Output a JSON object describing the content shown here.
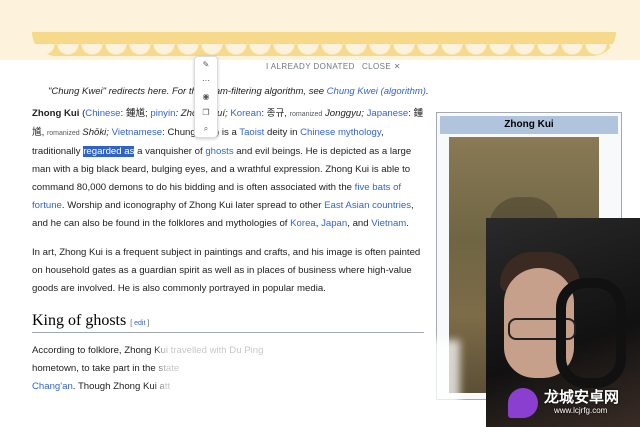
{
  "banner": {
    "donated_label": "I ALREADY DONATED",
    "close_label": "CLOSE ✕"
  },
  "hatnote": {
    "text": "\"Chung Kwei\" redirects here. For the spam-filtering algorithm, see ",
    "link": "Chung Kwei (algorithm)",
    "end": "."
  },
  "p1": {
    "name": "Zhong Kui",
    "s1": " (",
    "chinese_label": "Chinese",
    "chinese": ": 鍾馗; ",
    "pinyin_label": "pinyin",
    "pinyin": ": Zhōng Kuí; ",
    "korean_label": "Korean",
    "korean": ": 종규, ",
    "romanized1": "romanized",
    "korean_rom": " Jonggyu;",
    "japanese_label": "Japanese",
    "japanese": ": 鍾馗, ",
    "romanized2": "romanized",
    "shoki": " Shōki; ",
    "viet_label": "Vietnamese",
    "viet": ": Chung Quỳ) is a ",
    "taoist": "Taoist",
    "deity_in": " deity in ",
    "chinese_myth": "Chinese mythology",
    "trad_pre": ", traditionally ",
    "highlight": "regarded as",
    "trad_post": " a vanquisher of ",
    "ghosts": "ghosts",
    "rest1": " and evil beings. He is depicted as a large man with a big black beard, bulging eyes, and a wrathful expression. Zhong Kui is able to command 80,000 demons to do his bidding and is often associated with the ",
    "five_bats": "five bats of fortune",
    "rest2": ". Worship and iconography of Zhong Kui later spread to other ",
    "east_asian": "East Asian countries",
    "rest3": ", and he can also be found in the folklores and mythologies of ",
    "korea": "Korea",
    "comma": ", ",
    "japan": "Japan",
    "and": ", and ",
    "vietnam": "Vietnam",
    "end": "."
  },
  "p2": {
    "text": "In art, Zhong Kui is a frequent subject in paintings and crafts, and his image is often painted on household gates as a guardian spirit as well as in places of business where high-value goods are involved. He is also commonly portrayed in popular media."
  },
  "section": {
    "title": "King of ghosts",
    "edit": "edit"
  },
  "p3": {
    "l1": "According to folklore, Zhong Kui travelled with Du Ping",
    "l2": "hometown, to take part in the state",
    "l3_link": "Chang'an",
    "l3": ". Though Zhong Kui att"
  },
  "infobox": {
    "title": "Zhong Kui"
  },
  "logo": {
    "text": "龙城安卓网",
    "url": "www.lcjrfg.com"
  }
}
